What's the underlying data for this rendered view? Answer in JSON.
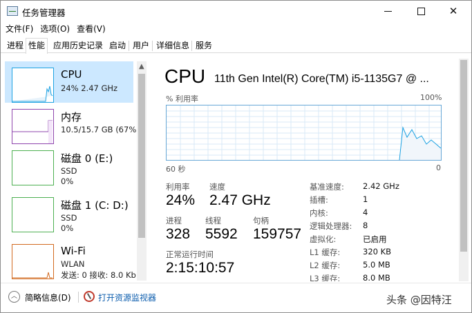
{
  "window": {
    "title": "任务管理器",
    "controls": {
      "minimize": "minimize",
      "maximize": "maximize",
      "close": "✕"
    }
  },
  "menu": [
    "文件(F)",
    "选项(O)",
    "查看(V)"
  ],
  "tabs": [
    "进程",
    "性能",
    "应用历史记录",
    "启动",
    "用户",
    "详细信息",
    "服务"
  ],
  "active_tab": "性能",
  "sidebar": {
    "items": [
      {
        "title": "CPU",
        "line1": "24% 2.47 GHz",
        "line2": "",
        "color": "#1ba1e2",
        "selected": true
      },
      {
        "title": "内存",
        "line1": "10.5/15.7 GB (67%)",
        "line2": "",
        "color": "#8e44ad",
        "selected": false
      },
      {
        "title": "磁盘 0 (E:)",
        "line1": "SSD",
        "line2": "0%",
        "color": "#4caf50",
        "selected": false
      },
      {
        "title": "磁盘 1 (C: D:)",
        "line1": "SSD",
        "line2": "0%",
        "color": "#4caf50",
        "selected": false
      },
      {
        "title": "Wi-Fi",
        "line1": "WLAN",
        "line2": "发送: 0 接收: 8.0 Kb",
        "color": "#d2691e",
        "selected": false
      }
    ]
  },
  "main": {
    "heading": "CPU",
    "cpu_name": "11th Gen Intel(R) Core(TM) i5-1135G7 @ ...",
    "graph": {
      "label_left": "% 利用率",
      "label_right": "100%",
      "foot_left": "60 秒",
      "foot_right": "0",
      "color": "#1ba1e2",
      "fill": "#f1f6fb"
    },
    "stats": {
      "util_label": "利用率",
      "util_value": "24%",
      "speed_label": "速度",
      "speed_value": "2.47 GHz",
      "proc_label": "进程",
      "proc_value": "328",
      "thread_label": "线程",
      "thread_value": "5592",
      "handle_label": "句柄",
      "handle_value": "159757",
      "uptime_label": "正常运行时间",
      "uptime_value": "2:15:10:57"
    },
    "details": [
      {
        "key": "基准速度:",
        "value": "2.42 GHz"
      },
      {
        "key": "插槽:",
        "value": "1"
      },
      {
        "key": "内核:",
        "value": "4"
      },
      {
        "key": "逻辑处理器:",
        "value": "8"
      },
      {
        "key": "虚拟化:",
        "value": "已启用"
      },
      {
        "key": "L1 缓存:",
        "value": "320 KB"
      },
      {
        "key": "L2 缓存:",
        "value": "5.0 MB"
      },
      {
        "key": "L3 缓存:",
        "value": "8.0 MB"
      }
    ]
  },
  "footer": {
    "fewer_details": "简略信息(D)",
    "open_monitor": "打开资源监视器",
    "watermark": "头条 @因特汪"
  }
}
